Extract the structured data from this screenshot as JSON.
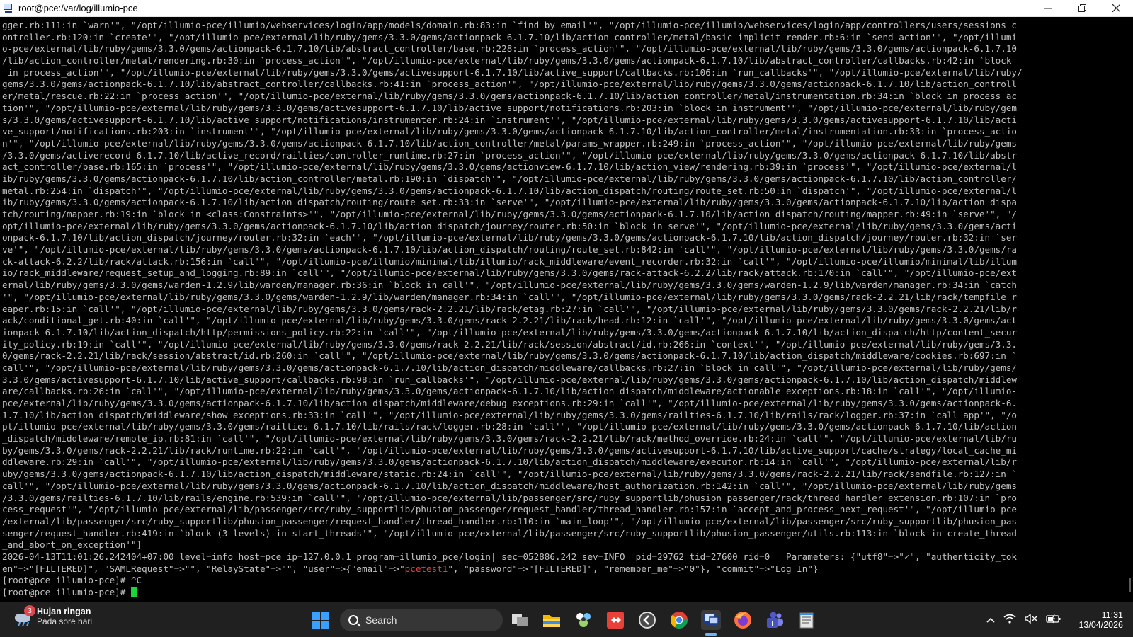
{
  "window": {
    "title": "root@pce:/var/log/illumio-pce"
  },
  "terminal": {
    "lines": [
      "gger.rb:111:in `warn'\", \"/opt/illumio-pce/illumio/webservices/login/app/models/domain.rb:83:in `find_by_email'\", \"/opt/illumio-pce/illumio/webservices/login/app/controllers/users/sessions_c",
      "ontroller.rb:120:in `create'\", \"/opt/illumio-pce/external/lib/ruby/gems/3.3.0/gems/actionpack-6.1.7.10/lib/action_controller/metal/basic_implicit_render.rb:6:in `send_action'\", \"/opt/illumi",
      "o-pce/external/lib/ruby/gems/3.3.0/gems/actionpack-6.1.7.10/lib/abstract_controller/base.rb:228:in `process_action'\", \"/opt/illumio-pce/external/lib/ruby/gems/3.3.0/gems/actionpack-6.1.7.10",
      "/lib/action_controller/metal/rendering.rb:30:in `process_action'\", \"/opt/illumio-pce/external/lib/ruby/gems/3.3.0/gems/actionpack-6.1.7.10/lib/abstract_controller/callbacks.rb:42:in `block",
      " in process_action'\", \"/opt/illumio-pce/external/lib/ruby/gems/3.3.0/gems/activesupport-6.1.7.10/lib/active_support/callbacks.rb:106:in `run_callbacks'\", \"/opt/illumio-pce/external/lib/ruby/",
      "gems/3.3.0/gems/actionpack-6.1.7.10/lib/abstract_controller/callbacks.rb:41:in `process_action'\", \"/opt/illumio-pce/external/lib/ruby/gems/3.3.0/gems/actionpack-6.1.7.10/lib/action_controll",
      "er/metal/rescue.rb:22:in `process_action'\", \"/opt/illumio-pce/external/lib/ruby/gems/3.3.0/gems/actionpack-6.1.7.10/lib/action_controller/metal/instrumentation.rb:34:in `block in process_ac",
      "tion'\", \"/opt/illumio-pce/external/lib/ruby/gems/3.3.0/gems/activesupport-6.1.7.10/lib/active_support/notifications.rb:203:in `block in instrument'\", \"/opt/illumio-pce/external/lib/ruby/gem",
      "s/3.3.0/gems/activesupport-6.1.7.10/lib/active_support/notifications/instrumenter.rb:24:in `instrument'\", \"/opt/illumio-pce/external/lib/ruby/gems/3.3.0/gems/activesupport-6.1.7.10/lib/acti",
      "ve_support/notifications.rb:203:in `instrument'\", \"/opt/illumio-pce/external/lib/ruby/gems/3.3.0/gems/actionpack-6.1.7.10/lib/action_controller/metal/instrumentation.rb:33:in `process_actio",
      "n'\", \"/opt/illumio-pce/external/lib/ruby/gems/3.3.0/gems/actionpack-6.1.7.10/lib/action_controller/metal/params_wrapper.rb:249:in `process_action'\", \"/opt/illumio-pce/external/lib/ruby/gems",
      "/3.3.0/gems/activerecord-6.1.7.10/lib/active_record/railties/controller_runtime.rb:27:in `process_action'\", \"/opt/illumio-pce/external/lib/ruby/gems/3.3.0/gems/actionpack-6.1.7.10/lib/abstr",
      "act_controller/base.rb:165:in `process'\", \"/opt/illumio-pce/external/lib/ruby/gems/3.3.0/gems/actionview-6.1.7.10/lib/action_view/rendering.rb:39:in `process'\", \"/opt/illumio-pce/external/l",
      "ib/ruby/gems/3.3.0/gems/actionpack-6.1.7.10/lib/action_controller/metal.rb:190:in `dispatch'\", \"/opt/illumio-pce/external/lib/ruby/gems/3.3.0/gems/actionpack-6.1.7.10/lib/action_controller/",
      "metal.rb:254:in `dispatch'\", \"/opt/illumio-pce/external/lib/ruby/gems/3.3.0/gems/actionpack-6.1.7.10/lib/action_dispatch/routing/route_set.rb:50:in `dispatch'\", \"/opt/illumio-pce/external/l",
      "ib/ruby/gems/3.3.0/gems/actionpack-6.1.7.10/lib/action_dispatch/routing/route_set.rb:33:in `serve'\", \"/opt/illumio-pce/external/lib/ruby/gems/3.3.0/gems/actionpack-6.1.7.10/lib/action_dispa",
      "tch/routing/mapper.rb:19:in `block in <class:Constraints>'\", \"/opt/illumio-pce/external/lib/ruby/gems/3.3.0/gems/actionpack-6.1.7.10/lib/action_dispatch/routing/mapper.rb:49:in `serve'\", \"/",
      "opt/illumio-pce/external/lib/ruby/gems/3.3.0/gems/actionpack-6.1.7.10/lib/action_dispatch/journey/router.rb:50:in `block in serve'\", \"/opt/illumio-pce/external/lib/ruby/gems/3.3.0/gems/acti",
      "onpack-6.1.7.10/lib/action_dispatch/journey/router.rb:32:in `each'\", \"/opt/illumio-pce/external/lib/ruby/gems/3.3.0/gems/actionpack-6.1.7.10/lib/action_dispatch/journey/router.rb:32:in `ser",
      "ve'\", \"/opt/illumio-pce/external/lib/ruby/gems/3.3.0/gems/actionpack-6.1.7.10/lib/action_dispatch/routing/route_set.rb:842:in `call'\", \"/opt/illumio-pce/external/lib/ruby/gems/3.3.0/gems/ra",
      "ck-attack-6.2.2/lib/rack/attack.rb:156:in `call'\", \"/opt/illumio-pce/illumio/minimal/lib/illumio/rack_middleware/event_recorder.rb:32:in `call'\", \"/opt/illumio-pce/illumio/minimal/lib/illum",
      "io/rack_middleware/request_setup_and_logging.rb:89:in `call'\", \"/opt/illumio-pce/external/lib/ruby/gems/3.3.0/gems/rack-attack-6.2.2/lib/rack/attack.rb:170:in `call'\", \"/opt/illumio-pce/ext",
      "ernal/lib/ruby/gems/3.3.0/gems/warden-1.2.9/lib/warden/manager.rb:36:in `block in call'\", \"/opt/illumio-pce/external/lib/ruby/gems/3.3.0/gems/warden-1.2.9/lib/warden/manager.rb:34:in `catch",
      "'\", \"/opt/illumio-pce/external/lib/ruby/gems/3.3.0/gems/warden-1.2.9/lib/warden/manager.rb:34:in `call'\", \"/opt/illumio-pce/external/lib/ruby/gems/3.3.0/gems/rack-2.2.21/lib/rack/tempfile_r",
      "eaper.rb:15:in `call'\", \"/opt/illumio-pce/external/lib/ruby/gems/3.3.0/gems/rack-2.2.21/lib/rack/etag.rb:27:in `call'\", \"/opt/illumio-pce/external/lib/ruby/gems/3.3.0/gems/rack-2.2.21/lib/r",
      "ack/conditional_get.rb:40:in `call'\", \"/opt/illumio-pce/external/lib/ruby/gems/3.3.0/gems/rack-2.2.21/lib/rack/head.rb:12:in `call'\", \"/opt/illumio-pce/external/lib/ruby/gems/3.3.0/gems/act",
      "ionpack-6.1.7.10/lib/action_dispatch/http/permissions_policy.rb:22:in `call'\", \"/opt/illumio-pce/external/lib/ruby/gems/3.3.0/gems/actionpack-6.1.7.10/lib/action_dispatch/http/content_secur",
      "ity_policy.rb:19:in `call'\", \"/opt/illumio-pce/external/lib/ruby/gems/3.3.0/gems/rack-2.2.21/lib/rack/session/abstract/id.rb:266:in `context'\", \"/opt/illumio-pce/external/lib/ruby/gems/3.3.",
      "0/gems/rack-2.2.21/lib/rack/session/abstract/id.rb:260:in `call'\", \"/opt/illumio-pce/external/lib/ruby/gems/3.3.0/gems/actionpack-6.1.7.10/lib/action_dispatch/middleware/cookies.rb:697:in `",
      "call'\", \"/opt/illumio-pce/external/lib/ruby/gems/3.3.0/gems/actionpack-6.1.7.10/lib/action_dispatch/middleware/callbacks.rb:27:in `block in call'\", \"/opt/illumio-pce/external/lib/ruby/gems/",
      "3.3.0/gems/activesupport-6.1.7.10/lib/active_support/callbacks.rb:98:in `run_callbacks'\", \"/opt/illumio-pce/external/lib/ruby/gems/3.3.0/gems/actionpack-6.1.7.10/lib/action_dispatch/middlew",
      "are/callbacks.rb:26:in `call'\", \"/opt/illumio-pce/external/lib/ruby/gems/3.3.0/gems/actionpack-6.1.7.10/lib/action_dispatch/middleware/actionable_exceptions.rb:18:in `call'\", \"/opt/illumio-",
      "pce/external/lib/ruby/gems/3.3.0/gems/actionpack-6.1.7.10/lib/action_dispatch/middleware/debug_exceptions.rb:29:in `call'\", \"/opt/illumio-pce/external/lib/ruby/gems/3.3.0/gems/actionpack-6.",
      "1.7.10/lib/action_dispatch/middleware/show_exceptions.rb:33:in `call'\", \"/opt/illumio-pce/external/lib/ruby/gems/3.3.0/gems/railties-6.1.7.10/lib/rails/rack/logger.rb:37:in `call_app'\", \"/o",
      "pt/illumio-pce/external/lib/ruby/gems/3.3.0/gems/railties-6.1.7.10/lib/rails/rack/logger.rb:28:in `call'\", \"/opt/illumio-pce/external/lib/ruby/gems/3.3.0/gems/actionpack-6.1.7.10/lib/action",
      "_dispatch/middleware/remote_ip.rb:81:in `call'\", \"/opt/illumio-pce/external/lib/ruby/gems/3.3.0/gems/rack-2.2.21/lib/rack/method_override.rb:24:in `call'\", \"/opt/illumio-pce/external/lib/ru",
      "by/gems/3.3.0/gems/rack-2.2.21/lib/rack/runtime.rb:22:in `call'\", \"/opt/illumio-pce/external/lib/ruby/gems/3.3.0/gems/activesupport-6.1.7.10/lib/active_support/cache/strategy/local_cache_mi",
      "ddleware.rb:29:in `call'\", \"/opt/illumio-pce/external/lib/ruby/gems/3.3.0/gems/actionpack-6.1.7.10/lib/action_dispatch/middleware/executor.rb:14:in `call'\", \"/opt/illumio-pce/external/lib/r",
      "uby/gems/3.3.0/gems/actionpack-6.1.7.10/lib/action_dispatch/middleware/static.rb:24:in `call'\", \"/opt/illumio-pce/external/lib/ruby/gems/3.3.0/gems/rack-2.2.21/lib/rack/sendfile.rb:127:in `",
      "call'\", \"/opt/illumio-pce/external/lib/ruby/gems/3.3.0/gems/actionpack-6.1.7.10/lib/action_dispatch/middleware/host_authorization.rb:142:in `call'\", \"/opt/illumio-pce/external/lib/ruby/gems",
      "/3.3.0/gems/railties-6.1.7.10/lib/rails/engine.rb:539:in `call'\", \"/opt/illumio-pce/external/lib/passenger/src/ruby_supportlib/phusion_passenger/rack/thread_handler_extension.rb:107:in `pro",
      "cess_request'\", \"/opt/illumio-pce/external/lib/passenger/src/ruby_supportlib/phusion_passenger/request_handler/thread_handler.rb:157:in `accept_and_process_next_request'\", \"/opt/illumio-pce",
      "/external/lib/passenger/src/ruby_supportlib/phusion_passenger/request_handler/thread_handler.rb:110:in `main_loop'\", \"/opt/illumio-pce/external/lib/passenger/src/ruby_supportlib/phusion_pas",
      "senger/request_handler.rb:419:in `block (3 levels) in start_threads'\", \"/opt/illumio-pce/external/lib/passenger/src/ruby_supportlib/phusion_passenger/utils.rb:113:in `block in create_thread",
      "_and_abort_on_exception'\"]",
      "2026-04-13T11:01:26.242404+07:00 level=info host=pce ip=127.0.0.1 program=illumio_pce/login| sec=052886.242 sev=INFO  pid=29762 tid=27600 rid=0   Parameters: {\"utf8\"=>\"✓\", \"authenticity_tok"
    ],
    "params_line": {
      "before": "en\"=>\"[FILTERED]\", \"SAMLRequest\"=>\"\", \"RelayState\"=>\"\", \"user\"=>{\"email\"=>\"",
      "highlight": "pcetest1",
      "after": "\", \"password\"=>\"[FILTERED]\", \"remember_me\"=>\"0\"}, \"commit\"=>\"Log In\"}"
    },
    "prompt_lines": [
      "[root@pce illumio-pce]# ^C",
      "[root@pce illumio-pce]# "
    ]
  },
  "taskbar": {
    "weather_badge": "3",
    "weather_title": "Hujan ringan",
    "weather_sub": "Pada sore hari",
    "search_label": "Search",
    "time": "11:31",
    "date": "13/04/2026"
  },
  "colors": {
    "terminal_bg": "#000000",
    "terminal_fg": "#c0c0c0",
    "highlight": "#e0443e",
    "cursor": "#19d43a",
    "taskbar_bg": "#202020"
  }
}
